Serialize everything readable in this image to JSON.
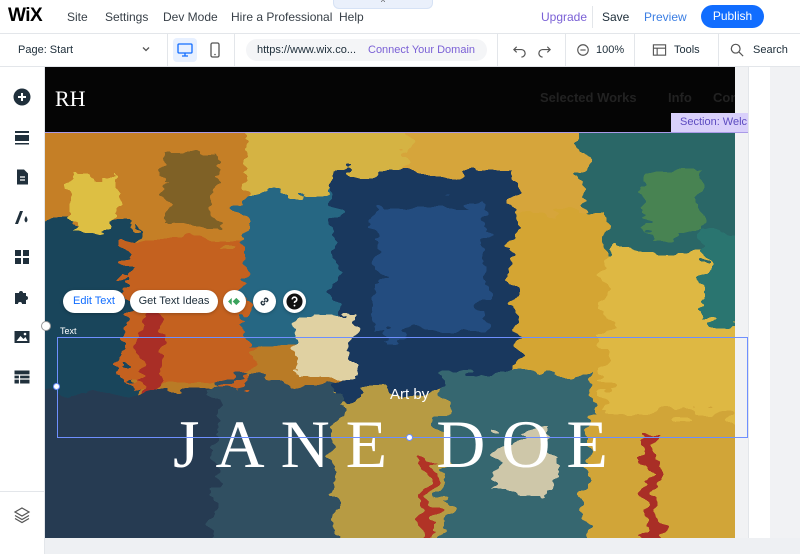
{
  "topbar": {
    "logo": "WiX",
    "menu": [
      "Site",
      "Settings",
      "Dev Mode",
      "Hire a Professional",
      "Help"
    ],
    "handle_glyph": "^",
    "upgrade": "Upgrade",
    "save": "Save",
    "preview": "Preview",
    "publish": "Publish"
  },
  "toolbar": {
    "page_label": "Page: Start",
    "url": "https://www.wix.co...",
    "connect_domain": "Connect Your Domain",
    "zoom": "100%",
    "tools": "Tools",
    "search": "Search"
  },
  "site": {
    "logo": "RH",
    "nav": [
      "Selected Works",
      "Info",
      "Cont"
    ]
  },
  "hero": {
    "subtitle": "Art by",
    "title": "JANE DOE"
  },
  "editor": {
    "section_label": "Section: Welc",
    "element_label": "Text",
    "edit_text": "Edit Text",
    "text_ideas": "Get Text Ideas"
  },
  "colors": {
    "brand_blue": "#116dff",
    "upgrade_purple": "#7b61d6",
    "selection_blue": "#6e8fff"
  }
}
